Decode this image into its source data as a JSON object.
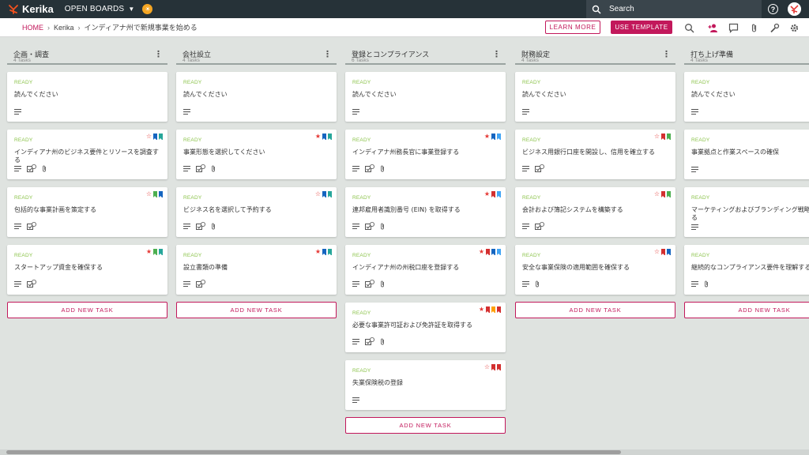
{
  "app": {
    "logo_text": "Kerika",
    "open_boards_label": "OPEN BOARDS",
    "search_label": "Search"
  },
  "breadcrumb": {
    "home": "HOME",
    "org": "Kerika",
    "board": "インディアナ州で新規事業を始める"
  },
  "actions": {
    "learn_more": "LEARN MORE",
    "use_template": "USE TEMPLATE"
  },
  "colors": {
    "brand": "#c2185b",
    "topbar": "#263238",
    "ready": "#8bc34a",
    "flag_green": "#4caf50",
    "flag_blue": "#1565c0",
    "flag_teal": "#26a69a",
    "flag_red": "#d32f2f",
    "flag_orange": "#ffa000",
    "flag_lightblue": "#42a5f5"
  },
  "add_task_label": "ADD NEW TASK",
  "columns": [
    {
      "title": "企画・調査",
      "count": "4 Tasks",
      "cards": [
        {
          "status": "READY",
          "title": "読んでください",
          "checklist": false,
          "attach": false,
          "flags": []
        },
        {
          "status": "READY",
          "title": "インディアナ州のビジネス要件とリソースを調査する",
          "checklist": true,
          "attach": true,
          "flags": [
            "star-outline",
            "#1565c0",
            "#26a69a"
          ]
        },
        {
          "status": "READY",
          "title": "包括的な事業計画を策定する",
          "checklist": true,
          "attach": false,
          "flags": [
            "star-outline",
            "#4caf50",
            "#1565c0"
          ]
        },
        {
          "status": "READY",
          "title": "スタートアップ資金を確保する",
          "checklist": true,
          "attach": false,
          "flags": [
            "star",
            "#4caf50",
            "#26a69a"
          ]
        }
      ]
    },
    {
      "title": "会社設立",
      "count": "4 Tasks",
      "cards": [
        {
          "status": "READY",
          "title": "読んでください",
          "checklist": false,
          "attach": false,
          "flags": []
        },
        {
          "status": "READY",
          "title": "事業形態を選択してください",
          "checklist": true,
          "attach": true,
          "flags": [
            "star",
            "#1565c0",
            "#26a69a"
          ]
        },
        {
          "status": "READY",
          "title": "ビジネス名を選択して予約する",
          "checklist": true,
          "attach": true,
          "flags": [
            "star-outline",
            "#1565c0",
            "#26a69a"
          ]
        },
        {
          "status": "READY",
          "title": "設立書類の準備",
          "checklist": true,
          "attach": false,
          "flags": [
            "star",
            "#1565c0",
            "#26a69a"
          ]
        }
      ]
    },
    {
      "title": "登録とコンプライアンス",
      "count": "6 Tasks",
      "cards": [
        {
          "status": "READY",
          "title": "読んでください",
          "checklist": false,
          "attach": false,
          "flags": []
        },
        {
          "status": "READY",
          "title": "インディアナ州務長官に事業登録する",
          "checklist": true,
          "attach": true,
          "flags": [
            "star",
            "#1565c0",
            "#42a5f5"
          ]
        },
        {
          "status": "READY",
          "title": "連邦雇用者識別番号 (EIN) を取得する",
          "checklist": true,
          "attach": true,
          "flags": [
            "star",
            "#d32f2f",
            "#42a5f5"
          ]
        },
        {
          "status": "READY",
          "title": "インディアナ州の州税口座を登録する",
          "checklist": true,
          "attach": true,
          "flags": [
            "star",
            "#d32f2f",
            "#1565c0",
            "#42a5f5"
          ]
        },
        {
          "status": "READY",
          "title": "必要な事業許可証および免許証を取得する",
          "checklist": true,
          "attach": true,
          "flags": [
            "star",
            "#d32f2f",
            "#ffa000",
            "#d32f2f"
          ]
        },
        {
          "status": "READY",
          "title": "失業保険税の登録",
          "checklist": false,
          "attach": false,
          "flags": [
            "star-outline",
            "#d32f2f",
            "#d32f2f"
          ]
        }
      ]
    },
    {
      "title": "財務設定",
      "count": "4 Tasks",
      "cards": [
        {
          "status": "READY",
          "title": "読んでください",
          "checklist": false,
          "attach": false,
          "flags": []
        },
        {
          "status": "READY",
          "title": "ビジネス用銀行口座を開設し、信用を確立する",
          "checklist": true,
          "attach": false,
          "flags": [
            "star-outline",
            "#d32f2f",
            "#4caf50"
          ]
        },
        {
          "status": "READY",
          "title": "会計および簿記システムを構築する",
          "checklist": true,
          "attach": false,
          "flags": [
            "star-outline",
            "#d32f2f",
            "#4caf50"
          ]
        },
        {
          "status": "READY",
          "title": "安全な事業保険の適用範囲を確保する",
          "checklist": false,
          "attach": true,
          "flags": [
            "star-outline",
            "#d32f2f",
            "#1565c0"
          ]
        }
      ]
    },
    {
      "title": "打ち上げ準備",
      "count": "4 Tasks",
      "cards": [
        {
          "status": "READY",
          "title": "読んでください",
          "checklist": false,
          "attach": false,
          "flags": []
        },
        {
          "status": "READY",
          "title": "事業拠点と作業スペースの確保",
          "checklist": false,
          "attach": false,
          "flags": []
        },
        {
          "status": "READY",
          "title": "マーケティングおよびブランディング戦略を策定する",
          "checklist": false,
          "attach": false,
          "flags": []
        },
        {
          "status": "READY",
          "title": "継続的なコンプライアンス要件を理解する",
          "checklist": false,
          "attach": true,
          "flags": []
        }
      ]
    }
  ]
}
